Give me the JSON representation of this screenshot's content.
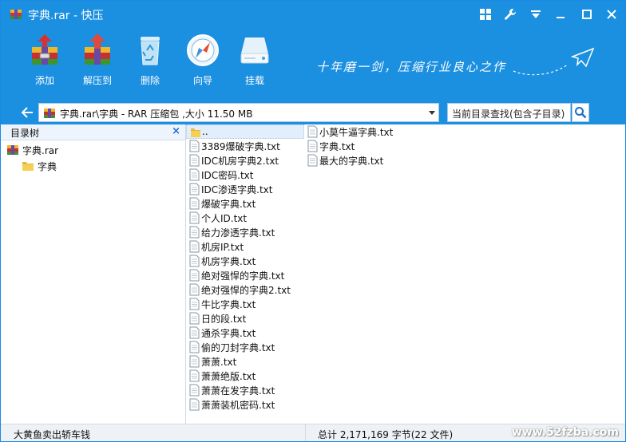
{
  "window": {
    "title": "字典.rar - 快压"
  },
  "toolbar": {
    "buttons": [
      {
        "label": "添加",
        "icon": "add-archive-icon"
      },
      {
        "label": "解压到",
        "icon": "extract-icon"
      },
      {
        "label": "删除",
        "icon": "recycle-bin-icon"
      },
      {
        "label": "向导",
        "icon": "compass-icon"
      },
      {
        "label": "挂载",
        "icon": "drive-mount-icon"
      }
    ],
    "slogan": "十年磨一剑，压缩行业良心之作"
  },
  "address": {
    "path": "字典.rar\\字典 - RAR 压缩包 ,大小 11.50 MB",
    "search_placeholder": "当前目录查找(包含子目录)"
  },
  "tree": {
    "header": "目录树",
    "close_glyph": "×",
    "nodes": [
      {
        "label": "字典.rar",
        "icon": "rar-archive-icon"
      },
      {
        "label": "字典",
        "icon": "folder-icon"
      }
    ]
  },
  "files": {
    "parent": "..",
    "column1": [
      "3389爆破字典.txt",
      "IDC机房字典2.txt",
      "IDC密码.txt",
      "IDC渗透字典.txt",
      "爆破字典.txt",
      "个人ID.txt",
      "给力渗透字典.txt",
      "机房IP.txt",
      "机房字典.txt",
      "绝对强悍的字典.txt",
      "绝对强悍的字典2.txt",
      "牛比字典.txt",
      "日的段.txt",
      "通杀字典.txt",
      "偷的刀封字典.txt",
      "萧萧.txt",
      "萧萧绝版.txt",
      "萧萧在发字典.txt",
      "萧萧装机密码.txt"
    ],
    "column2": [
      "小莫牛逼字典.txt",
      "字典.txt",
      "最大的字典.txt"
    ]
  },
  "status": {
    "left": "大黄鱼卖出轿车钱",
    "right": "总计  2,171,169 字节(22 文件)",
    "watermark": "www.52fzba.com"
  },
  "colors": {
    "accent": "#1b8fe0",
    "selection": "#e2eefb"
  }
}
